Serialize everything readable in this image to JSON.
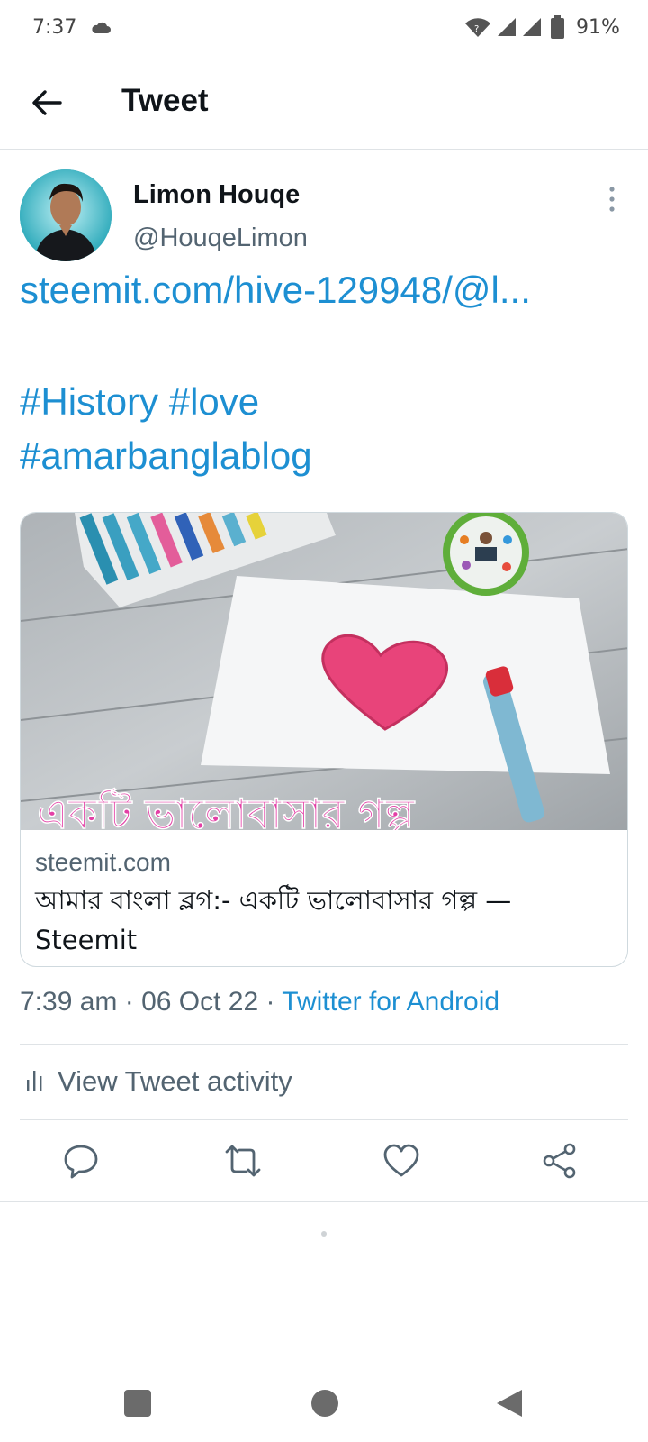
{
  "status_bar": {
    "time": "7:37",
    "battery": "91%"
  },
  "header": {
    "title": "Tweet",
    "back_icon": "arrow-left-icon"
  },
  "author": {
    "name": "Limon Houqe",
    "handle": "@HouqeLimon"
  },
  "tweet": {
    "link_text": "steemit.com/hive-129948/@l...",
    "hashtags": [
      "#History",
      "#love",
      "#amarbanglablog"
    ]
  },
  "card": {
    "image_overlay_text": "একটি ভালোবাসার গল্প",
    "domain": "steemit.com",
    "title": "আমার বাংলা ব্লগ:- একটি ভালোবাসার গল্প — Steemit"
  },
  "meta": {
    "time": "7:39 am",
    "date": "06 Oct 22",
    "separator": " · ",
    "source": "Twitter for Android"
  },
  "activity": {
    "label": "View Tweet activity"
  },
  "actions": [
    "reply-icon",
    "retweet-icon",
    "like-icon",
    "share-icon"
  ],
  "colors": {
    "link": "#1d8fd2",
    "secondary_text": "#536471",
    "divider": "#dfe3e6"
  }
}
